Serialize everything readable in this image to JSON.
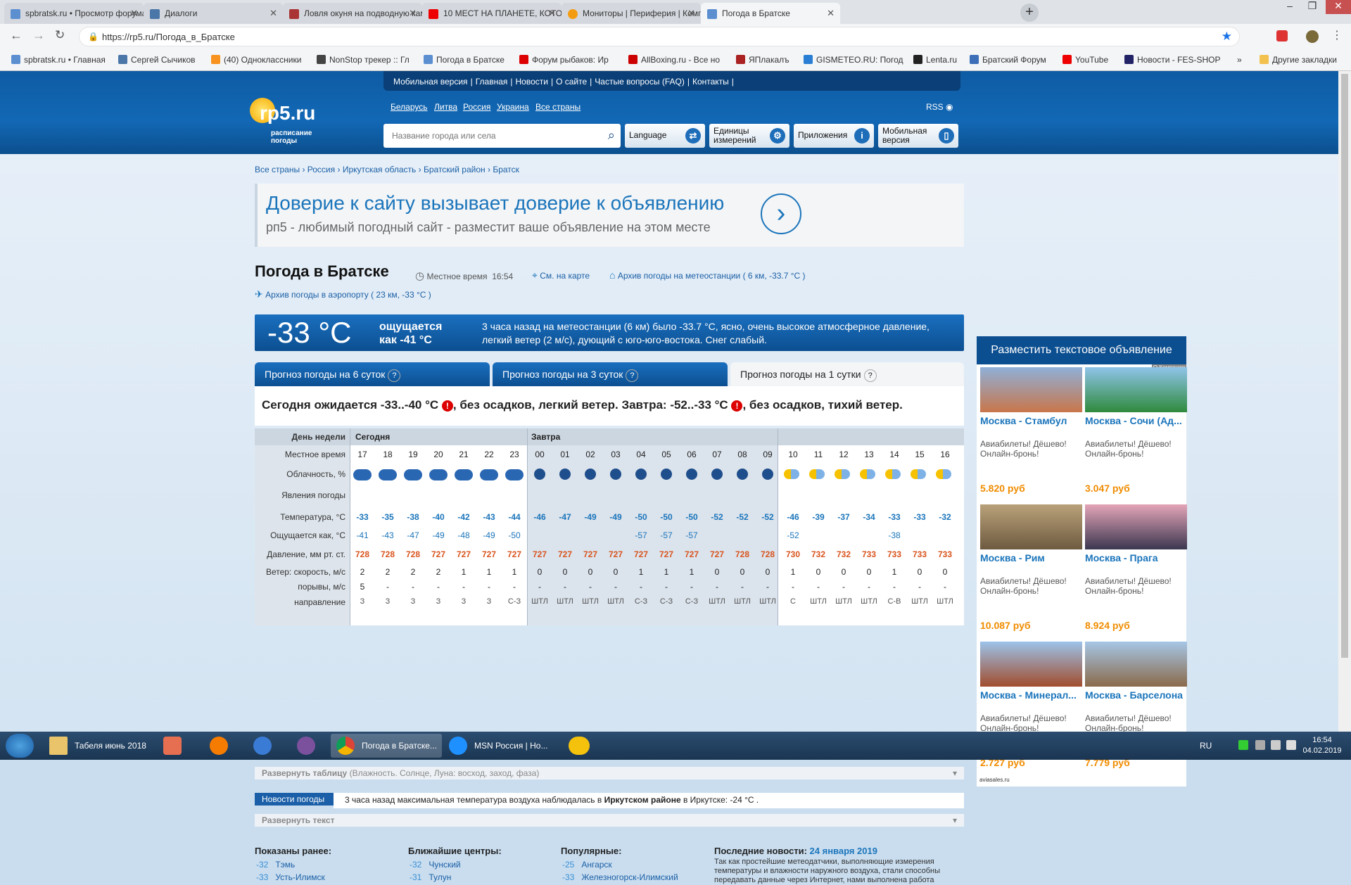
{
  "browser": {
    "tabs": [
      {
        "label": "spbratsk.ru • Просмотр форума"
      },
      {
        "label": "Диалоги"
      },
      {
        "label": "Ловля окуня на подводную кам"
      },
      {
        "label": "10 МЕСТ НА ПЛАНЕТЕ, КОТОРЫ"
      },
      {
        "label": "Мониторы | Периферия | Комп"
      },
      {
        "label": "Погода в Братске"
      }
    ],
    "url": "https://rp5.ru/Погода_в_Братске",
    "bookmarks": [
      {
        "label": "spbratsk.ru • Главная"
      },
      {
        "label": "Сергей Сычиков"
      },
      {
        "label": "(40) Одноклассники"
      },
      {
        "label": "NonStop трекер :: Гл"
      },
      {
        "label": "Погода в Братске"
      },
      {
        "label": "Форум рыбаков: Ир"
      },
      {
        "label": "AllBoxing.ru - Все но"
      },
      {
        "label": "ЯПлакалъ"
      },
      {
        "label": "GISMETEO.RU: Погод"
      },
      {
        "label": "Lenta.ru"
      },
      {
        "label": "Братский Форум"
      },
      {
        "label": "YouTube"
      },
      {
        "label": "Новости - FES-SHOP"
      }
    ],
    "more_bookmarks": "»",
    "other_bookmarks": "Другие закладки"
  },
  "site": {
    "topnav": [
      "Мобильная версия",
      "Главная",
      "Новости",
      "О сайте",
      "Частые вопросы (FAQ)",
      "Контакты"
    ],
    "logo_text": "rp5.ru",
    "logo_sub": "расписание погоды",
    "countries": [
      "Беларусь",
      "Литва",
      "Россия",
      "Украина",
      "Все страны"
    ],
    "rss": "RSS",
    "search_placeholder": "Название города или села",
    "btn_language": "Language",
    "btn_units": "Единицы измерений",
    "btn_apps": "Приложения",
    "btn_mobile": "Мобильная версия"
  },
  "breadcrumb": [
    "Все страны",
    "Россия",
    "Иркутская область",
    "Братский район",
    "Братск"
  ],
  "ad": {
    "title": "Доверие к сайту вызывает доверие к объявлению",
    "subtitle": "рп5 - любимый погодный сайт - разместит ваше объявление на этом месте"
  },
  "weather": {
    "city_title": "Погода в Братске",
    "local_time_label": "Местное время",
    "local_time": "16:54",
    "map_link": "См. на карте",
    "station_archive": "Архив погоды на метеостанции ( 6 км, -33.7 °C )",
    "airport_archive": "Архив погоды в аэропорту ( 23 км, -33 °C )",
    "now_temp": "-33 °C",
    "feels_label": "ощущается",
    "feels_value": "как -41 °C",
    "now_desc": "3 часа назад на метеостанции (6 км) было -33.7 °C, ясно, очень высокое атмосферное давление, легкий ветер (2 м/с), дующий с юго-юго-востока. Снег слабый.",
    "tabs": [
      "Прогноз погоды на 6 суток",
      "Прогноз погоды на 3 суток",
      "Прогноз погоды на 1 сутки"
    ],
    "summary_a": "Сегодня ожидается -33..-40 °C",
    "summary_b": ", без осадков, легкий ветер. Завтра: -52..-33 °C",
    "summary_c": ", без осадков, тихий ветер.",
    "expand_table": "Развернуть таблицу",
    "expand_table_note": "(Влажность. Солнце, Луна: восход, заход, фаза)"
  },
  "forecast": {
    "row_labels": {
      "day": "День недели",
      "time": "Местное время",
      "cloud": "Облачность, %",
      "phen": "Явления погоды",
      "temp": "Температура, °C",
      "feels": "Ощущается как, °C",
      "press": "Давление, мм рт. ст.",
      "wind": "Ветер: скорость, м/с",
      "gust": "порывы, м/с",
      "dir": "направление"
    },
    "day_today": "Сегодня",
    "day_tomorrow": "Завтра",
    "hours": [
      "17",
      "18",
      "19",
      "20",
      "21",
      "22",
      "23",
      "00",
      "01",
      "02",
      "03",
      "04",
      "05",
      "06",
      "07",
      "08",
      "09",
      "10",
      "11",
      "12",
      "13",
      "14",
      "15",
      "16"
    ],
    "temps": [
      "-33",
      "-35",
      "-38",
      "-40",
      "-42",
      "-43",
      "-44",
      "-46",
      "-47",
      "-49",
      "-49",
      "-50",
      "-50",
      "-50",
      "-52",
      "-52",
      "-52",
      "-46",
      "-39",
      "-37",
      "-34",
      "-33",
      "-33",
      "-32"
    ],
    "feels": [
      "-41",
      "-43",
      "-47",
      "-49",
      "-48",
      "-49",
      "-50",
      "",
      "",
      "",
      "",
      "-57",
      "-57",
      "-57",
      "",
      "",
      "",
      "-52",
      "",
      "",
      "",
      "-38",
      "",
      ""
    ],
    "pressure": [
      "728",
      "728",
      "728",
      "727",
      "727",
      "727",
      "727",
      "727",
      "727",
      "727",
      "727",
      "727",
      "727",
      "727",
      "727",
      "728",
      "728",
      "730",
      "732",
      "732",
      "733",
      "733",
      "733",
      "733"
    ],
    "wind": [
      "2",
      "2",
      "2",
      "2",
      "1",
      "1",
      "1",
      "0",
      "0",
      "0",
      "0",
      "1",
      "1",
      "1",
      "0",
      "0",
      "0",
      "1",
      "0",
      "0",
      "0",
      "1",
      "0",
      "0"
    ],
    "gust": [
      "5",
      "-",
      "-",
      "-",
      "-",
      "-",
      "-",
      "-",
      "-",
      "-",
      "-",
      "-",
      "-",
      "-",
      "-",
      "-",
      "-",
      "-",
      "-",
      "-",
      "-",
      "-",
      "-",
      "-"
    ],
    "dir": [
      "З",
      "З",
      "З",
      "З",
      "З",
      "З",
      "С-З",
      "ШТЛ",
      "ШТЛ",
      "ШТЛ",
      "ШТЛ",
      "С-З",
      "С-З",
      "С-З",
      "ШТЛ",
      "ШТЛ",
      "ШТЛ",
      "С",
      "ШТЛ",
      "ШТЛ",
      "ШТЛ",
      "С-В",
      "ШТЛ",
      "ШТЛ"
    ]
  },
  "news": {
    "header": "Новости погоды",
    "text_a": "3 часа назад максимальная температура воздуха наблюдалась в ",
    "text_b": "Иркутском районе",
    "text_c": " в Иркутске: -24 °C .",
    "expand": "Развернуть текст"
  },
  "footer": {
    "shown_title": "Показаны ранее:",
    "shown": [
      {
        "t": "-32",
        "n": "Тэмь"
      },
      {
        "t": "-33",
        "n": "Усть-Илимск"
      }
    ],
    "near_title": "Ближайшие центры:",
    "near": [
      {
        "t": "-32",
        "n": "Чунский"
      },
      {
        "t": "-31",
        "n": "Тулун"
      }
    ],
    "popular_title": "Популярные:",
    "popular": [
      {
        "t": "-25",
        "n": "Ангарск"
      },
      {
        "t": "-33",
        "n": "Железногорск-Илимский"
      }
    ],
    "latest_title": "Последние новости:",
    "latest_date": "24 января 2019",
    "latest_text": "Так как простейшие метеодатчики, выполняющие измерения температуры и влажности наружного воздуха, стали способны передавать данные через Интернет, нами выполнена работа"
  },
  "side": {
    "button": "Разместить текстовое объявление",
    "company": "О Компании",
    "tickets": [
      {
        "dest": "Москва - Стамбул",
        "desc": "Авиабилеты! Дёшево! Онлайн-бронь!",
        "price": "5.820 руб"
      },
      {
        "dest": "Москва - Сочи (Ад...",
        "desc": "Авиабилеты! Дёшево! Онлайн-бронь!",
        "price": "3.047 руб"
      },
      {
        "dest": "Москва - Рим",
        "desc": "Авиабилеты! Дёшево! Онлайн-бронь!",
        "price": "10.087 руб"
      },
      {
        "dest": "Москва - Прага",
        "desc": "Авиабилеты! Дёшево! Онлайн-бронь!",
        "price": "8.924 руб"
      },
      {
        "dest": "Москва - Минерал...",
        "desc": "Авиабилеты! Дёшево! Онлайн-бронь!",
        "price": "2.727 руб"
      },
      {
        "dest": "Москва - Барселона",
        "desc": "Авиабилеты! Дёшево! Онлайн-бронь!",
        "price": "7.779 руб"
      }
    ],
    "source": "aviasales.ru"
  },
  "taskbar": {
    "items": [
      {
        "label": "Табеля июнь 2018"
      },
      {
        "label": "Погода в Братске..."
      },
      {
        "label": "MSN Россия | Но..."
      }
    ],
    "lang": "RU",
    "time": "16:54",
    "date": "04.02.2019"
  },
  "colors": {
    "accent": "#1b75bb",
    "header": "#1268b5",
    "pressure": "#d9541e",
    "price": "#f08c00"
  }
}
